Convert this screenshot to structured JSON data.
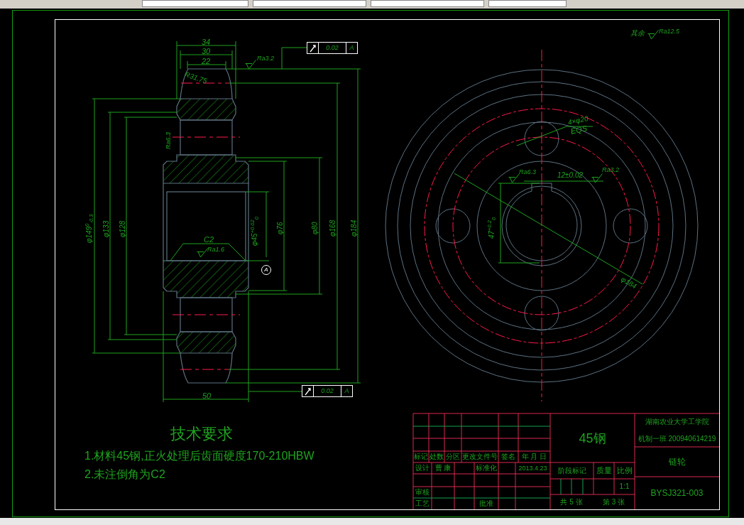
{
  "top_right_note": {
    "text": "其余",
    "roughness": "Ra12.5"
  },
  "front_view": {
    "labels": [
      {
        "kind": "horizontal",
        "text": "34"
      },
      {
        "kind": "horizontal",
        "text": "30"
      },
      {
        "kind": "horizontal",
        "text": "22"
      },
      {
        "kind": "slanted",
        "text": "R31.75"
      },
      {
        "kind": "roughness",
        "text": "Ra3.2"
      },
      {
        "kind": "vertical_roughness",
        "text": "Ra6.3"
      },
      {
        "kind": "horizontal",
        "text": "C2"
      },
      {
        "kind": "roughness",
        "text": "Ra1.6"
      },
      {
        "kind": "horizontal",
        "text": "50"
      },
      {
        "kind": "vertical",
        "text": "φ149$^{0}$$_{-0.3}$"
      },
      {
        "kind": "vertical",
        "text": "φ133"
      },
      {
        "kind": "vertical",
        "text": "φ128"
      },
      {
        "kind": "vertical",
        "text": "φ45$^{+0.02}$$_{0}$"
      },
      {
        "kind": "vertical",
        "text": "φ76"
      },
      {
        "kind": "vertical",
        "text": "φ80"
      },
      {
        "kind": "vertical",
        "text": "φ168"
      },
      {
        "kind": "vertical",
        "text": "φ184"
      }
    ]
  },
  "feature_control_frames": [
    {
      "value": "0.02",
      "datum": "A"
    },
    {
      "value": "0.02",
      "datum": "A"
    }
  ],
  "datum_label": "A",
  "end_view": {
    "labels": [
      {
        "kind": "horizontal",
        "text": "4×φ20"
      },
      {
        "kind": "horizontal",
        "text": "EQS"
      },
      {
        "kind": "roughness",
        "text": "Ra6.3"
      },
      {
        "kind": "horizontal",
        "text": "12±0.02"
      },
      {
        "kind": "roughness",
        "text": "Ra3.2"
      },
      {
        "kind": "vertical",
        "text": "47$^{+0.2}$$_{0}$"
      },
      {
        "kind": "slanted",
        "text": "φ184"
      }
    ]
  },
  "technical_requirements": {
    "title": "技术要求",
    "items": [
      "1.材料45钢,正火处理后齿面硬度170-210HBW",
      "2.未注倒角为C2"
    ]
  },
  "title_block": {
    "revision_headers": [
      "标记",
      "处数",
      "分区",
      "更改文件号",
      "签名",
      "年 月 日"
    ],
    "designer_row": [
      "设计",
      "曹 康",
      "标准化",
      "2013.4.23"
    ],
    "review": "审核",
    "process": "工艺",
    "approve": "批准",
    "material": "45钢",
    "stage_headers": [
      "阶段标记",
      "质量",
      "比例"
    ],
    "scale": "1:1",
    "sheets": "共 5 张",
    "sheet": "第 3 张",
    "school": "湖南农业大学工学院",
    "class_id": "机制一班 200940614219",
    "part_name": "链轮",
    "drawing_number": "BYSJ321-003"
  }
}
